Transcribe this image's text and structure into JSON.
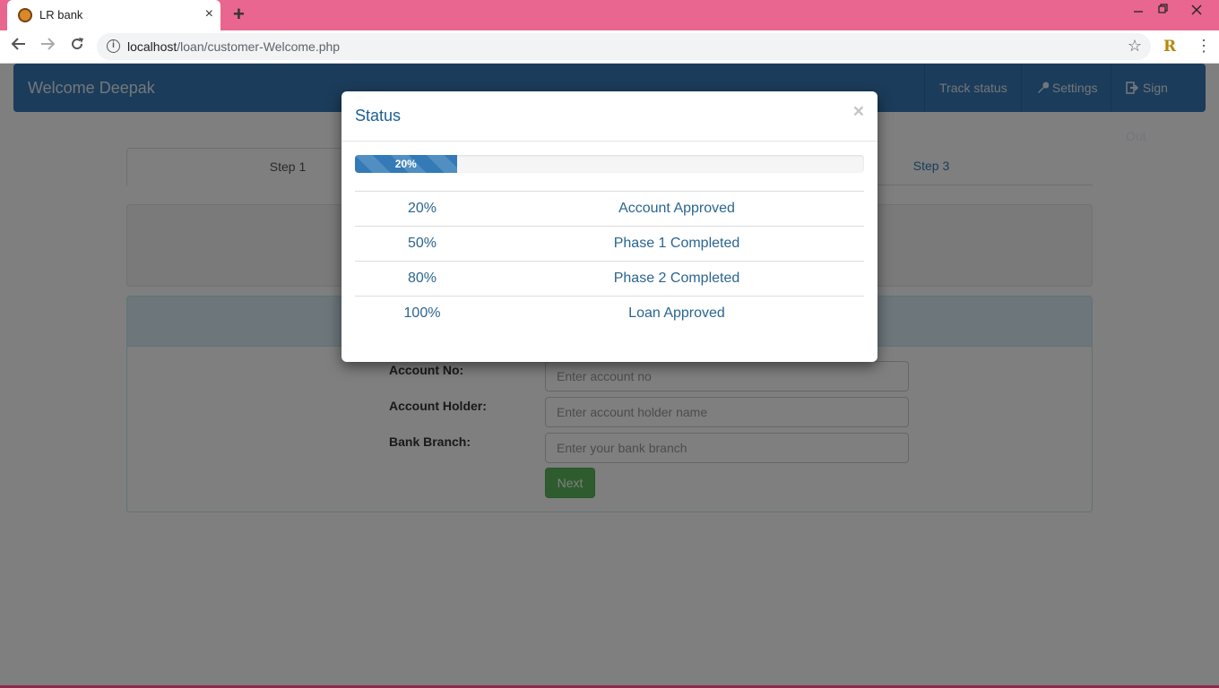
{
  "browser": {
    "tab_title": "LR bank",
    "tab_close": "×",
    "new_tab": "+",
    "url_host": "localhost",
    "url_path": "/loan/customer-Welcome.php",
    "info_glyph": "i",
    "extension_letter": "R",
    "icons": [
      "favicon-icon",
      "back-icon",
      "forward-icon",
      "reload-icon",
      "star-icon",
      "menu-icon",
      "minimize-icon",
      "restore-icon",
      "close-icon"
    ]
  },
  "navbar": {
    "brand": "Welcome Deepak",
    "items": [
      {
        "label": "Track status",
        "icon": ""
      },
      {
        "label": "Settings",
        "icon": "wrench-icon"
      },
      {
        "label": "Sign Out",
        "icon": "sign-out-icon"
      }
    ]
  },
  "steps": {
    "step1": "Step 1",
    "step3": "Step 3"
  },
  "form": {
    "account_no_label": "Account No:",
    "account_no_placeholder": "Enter account no",
    "holder_label": "Account Holder:",
    "holder_placeholder": "Enter account holder name",
    "branch_label": "Bank Branch:",
    "branch_placeholder": "Enter your bank branch",
    "next_label": "Next"
  },
  "modal": {
    "title": "Status",
    "close": "×",
    "progress_percent": 20,
    "progress_label": "20%",
    "rows": [
      {
        "percent": "20%",
        "status": "Account Approved"
      },
      {
        "percent": "50%",
        "status": "Phase 1 Completed"
      },
      {
        "percent": "80%",
        "status": "Phase 2 Completed"
      },
      {
        "percent": "100%",
        "status": "Loan Approved"
      }
    ]
  },
  "colors": {
    "titlebar": "#e8668f",
    "navbar": "#3679b5",
    "progress": "#337ab7",
    "next_button": "#5cb85c"
  }
}
